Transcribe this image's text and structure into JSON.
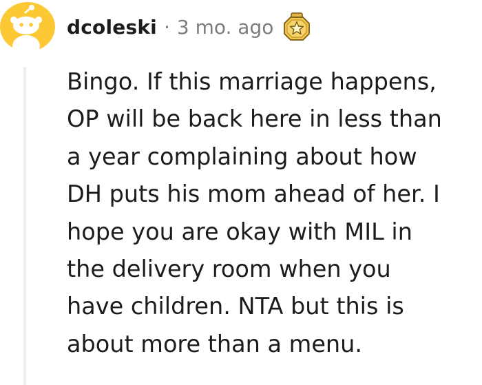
{
  "comment": {
    "username": "dcoleski",
    "separator": "·",
    "timestamp": "3 mo. ago",
    "avatar_icon": "snoo-avatar-icon",
    "award_icon": "star-award-icon",
    "colors": {
      "avatar_bg": "#fcc934",
      "award_gold": "#e2b44a",
      "text": "#1c1c1c",
      "meta": "#7c7c7c"
    },
    "body_lines": [
      "Bingo. If this marriage happens,",
      "OP will be back here in less than",
      "a year complaining about how",
      "DH puts his mom ahead of her. I",
      "hope you are okay with MIL in",
      "the delivery room when you",
      "have children. NTA but this is",
      "about more than a menu."
    ]
  }
}
